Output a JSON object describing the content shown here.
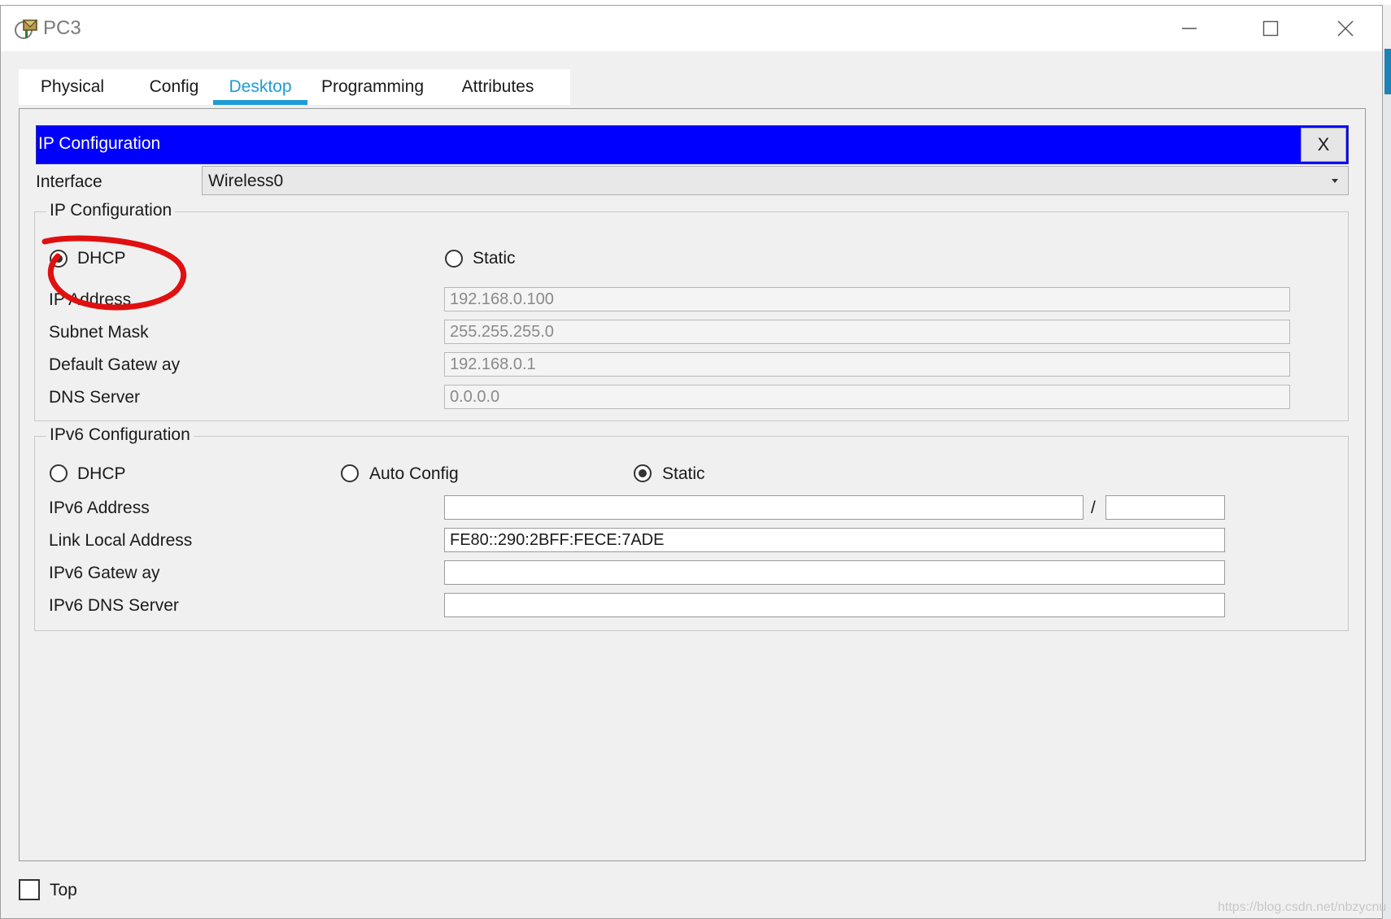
{
  "window": {
    "title": "PC3"
  },
  "tabs": [
    {
      "label": "Physical"
    },
    {
      "label": "Config"
    },
    {
      "label": "Desktop"
    },
    {
      "label": "Programming"
    },
    {
      "label": "Attributes"
    }
  ],
  "active_tab": "Desktop",
  "panel": {
    "title": "IP Configuration",
    "close_label": "X"
  },
  "interface": {
    "label": "Interface",
    "selected": "Wireless0"
  },
  "ipv4": {
    "group_title": "IP Configuration",
    "dhcp_label": "DHCP",
    "static_label": "Static",
    "mode": "DHCP",
    "ip_label": "IP Address",
    "ip_value": "192.168.0.100",
    "mask_label": "Subnet Mask",
    "mask_value": "255.255.255.0",
    "gateway_label": "Default Gatew ay",
    "gateway_value": "192.168.0.1",
    "dns_label": "DNS Server",
    "dns_value": "0.0.0.0"
  },
  "ipv6": {
    "group_title": "IPv6 Configuration",
    "dhcp_label": "DHCP",
    "auto_label": "Auto Config",
    "static_label": "Static",
    "mode": "Static",
    "address_label": "IPv6 Address",
    "address_value": "",
    "prefix_separator": "/",
    "prefix_value": "",
    "link_local_label": "Link Local Address",
    "link_local_value": "FE80::290:2BFF:FECE:7ADE",
    "gateway_label": "IPv6 Gatew ay",
    "gateway_value": "",
    "dns_label": "IPv6 DNS Server",
    "dns_value": ""
  },
  "footer": {
    "top_label": "Top",
    "top_checked": false
  },
  "watermark": "https://blog.csdn.net/nbzycnu",
  "colors": {
    "header_blue": "#0000ff",
    "tab_accent": "#1e9bd7",
    "annotation_red": "#e01010"
  }
}
